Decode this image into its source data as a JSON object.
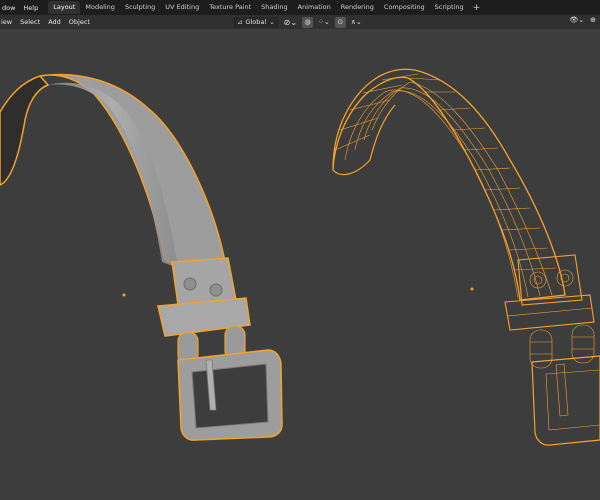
{
  "topbar": {
    "menus": [
      "dow",
      "Help"
    ],
    "tabs": [
      {
        "label": "Layout",
        "active": true
      },
      {
        "label": "Modeling",
        "active": false
      },
      {
        "label": "Sculpting",
        "active": false
      },
      {
        "label": "UV Editing",
        "active": false
      },
      {
        "label": "Texture Paint",
        "active": false
      },
      {
        "label": "Shading",
        "active": false
      },
      {
        "label": "Animation",
        "active": false
      },
      {
        "label": "Rendering",
        "active": false
      },
      {
        "label": "Compositing",
        "active": false
      },
      {
        "label": "Scripting",
        "active": false
      }
    ],
    "add_tab": "+"
  },
  "toolbar": {
    "menus": [
      "iew",
      "Select",
      "Add",
      "Object"
    ],
    "orientation": "Global"
  },
  "colors": {
    "selection_outline": "#f5a22a",
    "mesh_gray": "#a3a3a3",
    "viewport_bg": "#3d3d3d"
  }
}
